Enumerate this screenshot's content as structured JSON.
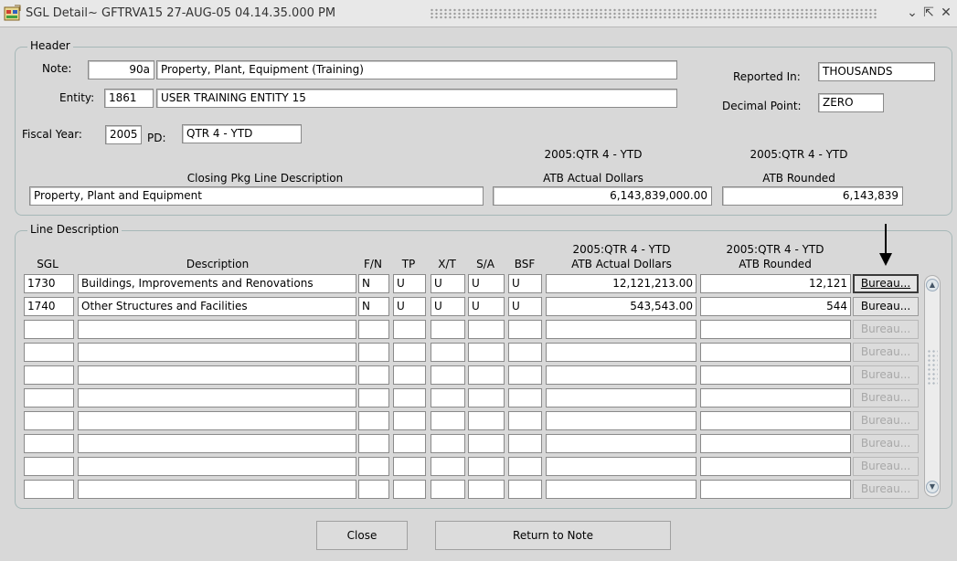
{
  "window": {
    "title": "SGL Detail~ GFTRVA15  27-AUG-05 04.14.35.000 PM",
    "controls": [
      "minimize-icon",
      "maximize-icon",
      "close-icon"
    ]
  },
  "header": {
    "title": "Header",
    "note_label": "Note:",
    "note_number": "90a",
    "note_description": "Property, Plant, Equipment (Training)",
    "entity_label": "Entity:",
    "entity_number": "1861",
    "entity_name": "USER TRAINING ENTITY 15",
    "reported_in_label": "Reported In:",
    "reported_in_value": "THOUSANDS",
    "decimal_point_label": "Decimal Point:",
    "decimal_point_value": "ZERO",
    "fiscal_year_label": "Fiscal Year:",
    "fiscal_year_value": "2005",
    "pd_label": "PD:",
    "pd_value": "QTR 4 - YTD",
    "col_period_1": "2005:QTR 4 - YTD",
    "col_period_2": "2005:QTR 4 - YTD",
    "col_closing_desc": "Closing Pkg Line Description",
    "col_actual": "ATB Actual Dollars",
    "col_rounded": "ATB Rounded",
    "closing_desc_value": "Property, Plant and Equipment",
    "actual_value": "6,143,839,000.00",
    "rounded_value": "6,143,839"
  },
  "lines": {
    "title": "Line Description",
    "headers": {
      "sgl": "SGL",
      "description": "Description",
      "fn": "F/N",
      "tp": "TP",
      "xt": "X/T",
      "sa": "S/A",
      "bsf": "BSF",
      "period_actual": "2005:QTR 4 - YTD",
      "actual": "ATB Actual Dollars",
      "period_rounded": "2005:QTR 4 - YTD",
      "rounded": "ATB Rounded"
    },
    "rows": [
      {
        "sgl": "1730",
        "description": "Buildings, Improvements and Renovations",
        "fn": "N",
        "tp": "U",
        "xt": "U",
        "sa": "U",
        "bsf": "U",
        "actual": "12,121,213.00",
        "rounded": "12,121",
        "button": "Bureau..."
      },
      {
        "sgl": "1740",
        "description": "Other Structures and Facilities",
        "fn": "N",
        "tp": "U",
        "xt": "U",
        "sa": "U",
        "bsf": "U",
        "actual": "543,543.00",
        "rounded": "544",
        "button": "Bureau..."
      },
      {
        "sgl": "",
        "description": "",
        "fn": "",
        "tp": "",
        "xt": "",
        "sa": "",
        "bsf": "",
        "actual": "",
        "rounded": "",
        "button": "Bureau..."
      },
      {
        "sgl": "",
        "description": "",
        "fn": "",
        "tp": "",
        "xt": "",
        "sa": "",
        "bsf": "",
        "actual": "",
        "rounded": "",
        "button": "Bureau..."
      },
      {
        "sgl": "",
        "description": "",
        "fn": "",
        "tp": "",
        "xt": "",
        "sa": "",
        "bsf": "",
        "actual": "",
        "rounded": "",
        "button": "Bureau..."
      },
      {
        "sgl": "",
        "description": "",
        "fn": "",
        "tp": "",
        "xt": "",
        "sa": "",
        "bsf": "",
        "actual": "",
        "rounded": "",
        "button": "Bureau..."
      },
      {
        "sgl": "",
        "description": "",
        "fn": "",
        "tp": "",
        "xt": "",
        "sa": "",
        "bsf": "",
        "actual": "",
        "rounded": "",
        "button": "Bureau..."
      },
      {
        "sgl": "",
        "description": "",
        "fn": "",
        "tp": "",
        "xt": "",
        "sa": "",
        "bsf": "",
        "actual": "",
        "rounded": "",
        "button": "Bureau..."
      },
      {
        "sgl": "",
        "description": "",
        "fn": "",
        "tp": "",
        "xt": "",
        "sa": "",
        "bsf": "",
        "actual": "",
        "rounded": "",
        "button": "Bureau..."
      },
      {
        "sgl": "",
        "description": "",
        "fn": "",
        "tp": "",
        "xt": "",
        "sa": "",
        "bsf": "",
        "actual": "",
        "rounded": "",
        "button": "Bureau..."
      }
    ]
  },
  "footer": {
    "close_label": "Close",
    "return_label": "Return to Note"
  }
}
